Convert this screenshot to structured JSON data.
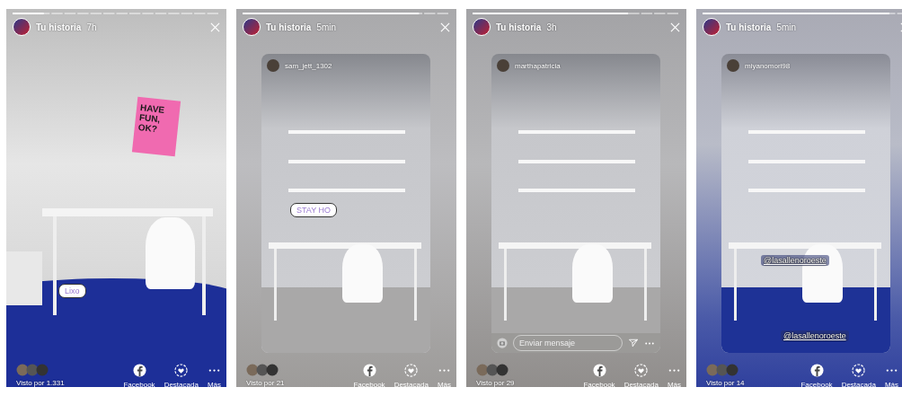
{
  "stories": [
    {
      "kind": "own",
      "author": "Tu historia",
      "time": "7h",
      "progress": {
        "level": 0.15
      },
      "stickers": [
        {
          "kind": "poster",
          "text": "HAVE FUN, OK?"
        },
        {
          "kind": "label",
          "text": "Lixo"
        }
      ],
      "viewers": "Visto por 1.331",
      "actions": [
        {
          "kind": "facebook",
          "label": "Facebook"
        },
        {
          "kind": "highlight",
          "label": "Destacada"
        },
        {
          "kind": "more",
          "label": "Más"
        }
      ]
    },
    {
      "kind": "shared",
      "author": "Tu historia",
      "time": "5min",
      "progress": {
        "level": 0.85
      },
      "shared_from": "sam_jett_1302",
      "stickers": [
        {
          "kind": "label",
          "text": "STAY HO"
        }
      ],
      "viewers": "Visto por 21",
      "actions": [
        {
          "kind": "facebook",
          "label": "Facebook"
        },
        {
          "kind": "highlight",
          "label": "Destacada"
        },
        {
          "kind": "more",
          "label": "Más"
        }
      ]
    },
    {
      "kind": "shared",
      "author": "Tu historia",
      "time": "3h",
      "progress": {
        "level": 0.75
      },
      "shared_from": "marthapatricia",
      "message_placeholder": "Enviar mensaje",
      "viewers": "Visto por 29",
      "actions": [
        {
          "kind": "facebook",
          "label": "Facebook"
        },
        {
          "kind": "highlight",
          "label": "Destacada"
        },
        {
          "kind": "more",
          "label": "Más"
        }
      ]
    },
    {
      "kind": "shared",
      "author": "Tu historia",
      "time": "5min",
      "progress": {
        "level": 0.9
      },
      "shared_from": "miyanomori98",
      "stickers": [
        {
          "kind": "mention",
          "text": "@lasallenoroeste"
        },
        {
          "kind": "mention",
          "text": "@lasallenoroeste"
        }
      ],
      "viewers": "Visto por 14",
      "actions": [
        {
          "kind": "facebook",
          "label": "Facebook"
        },
        {
          "kind": "highlight",
          "label": "Destacada"
        },
        {
          "kind": "more",
          "label": "Más"
        }
      ]
    }
  ]
}
